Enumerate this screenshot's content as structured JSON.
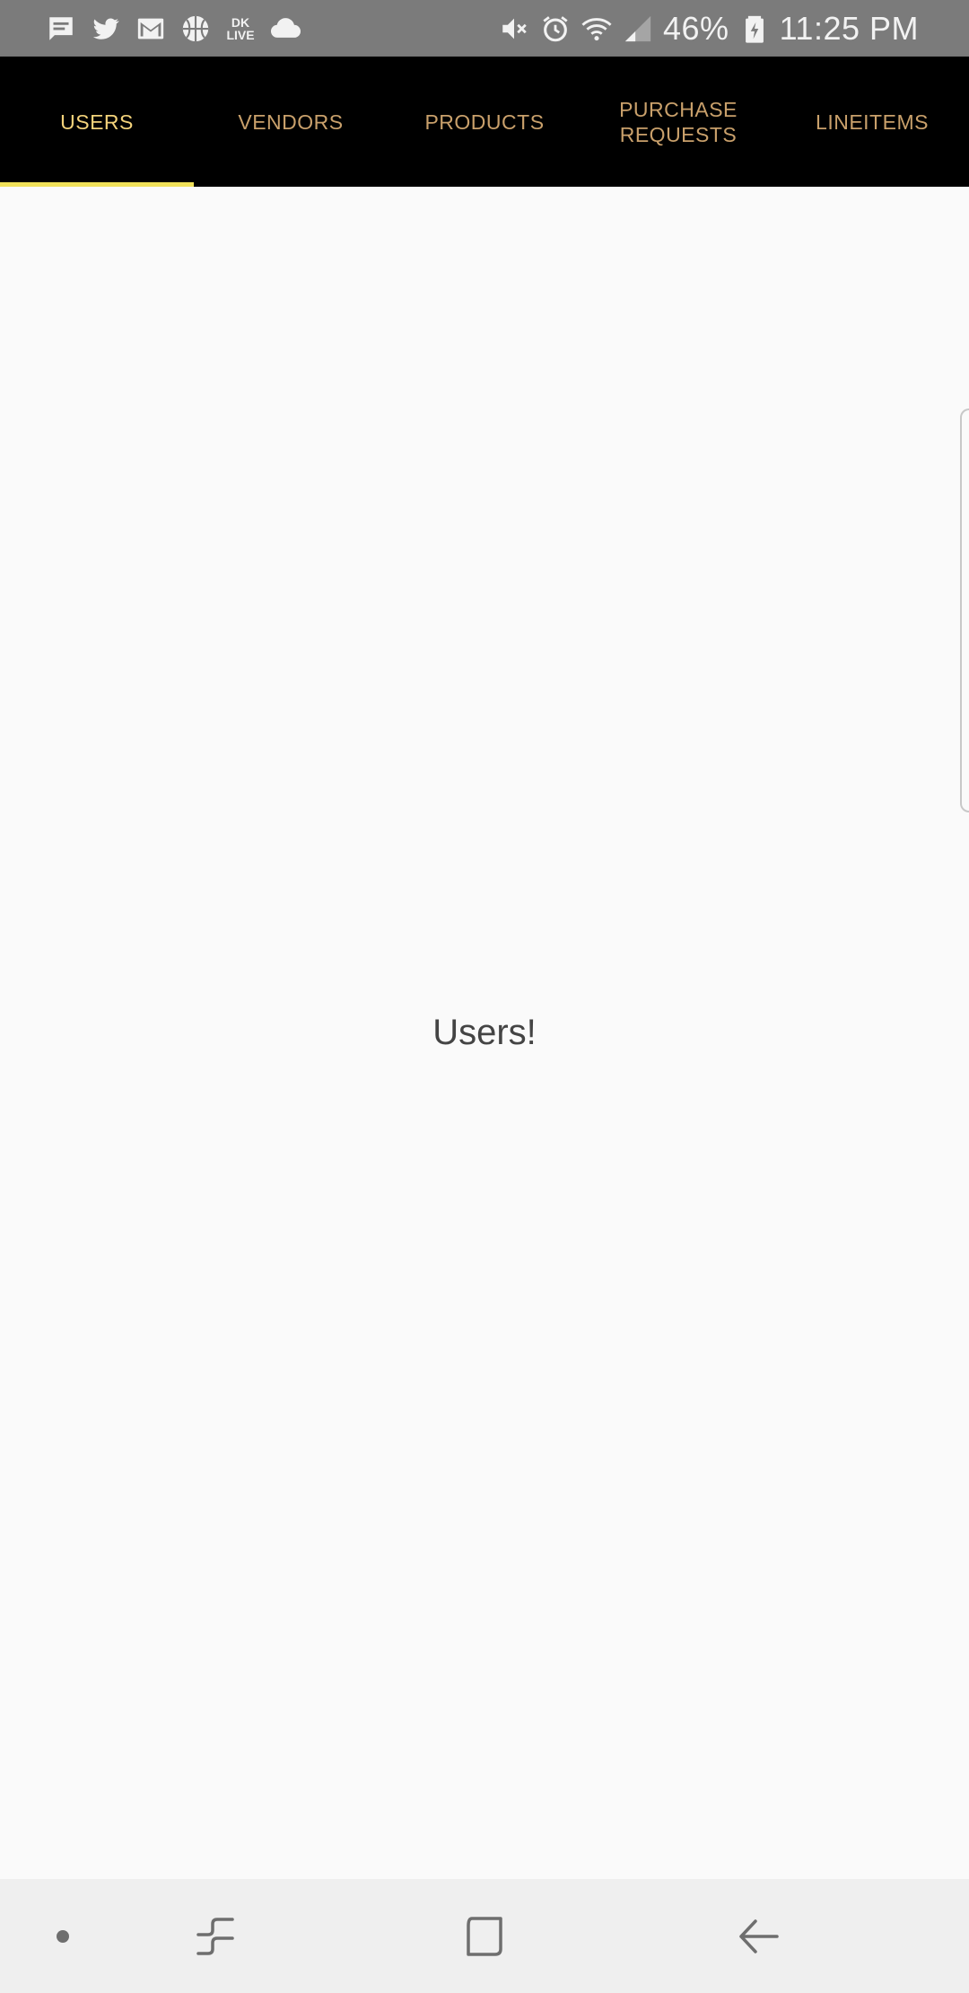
{
  "status_bar": {
    "notification_icons": [
      "message-icon",
      "twitter-icon",
      "gmail-icon",
      "basketball-icon",
      "dk-live-icon",
      "cloud-icon"
    ],
    "dk_live_text_top": "DK",
    "dk_live_text_bottom": "LIVE",
    "system_icons": [
      "mute-icon",
      "alarm-icon",
      "wifi-icon",
      "signal-icon",
      "battery-charging-icon"
    ],
    "battery_percent": "46%",
    "time": "11:25 PM"
  },
  "tabs": [
    {
      "label": "USERS",
      "active": true
    },
    {
      "label": "VENDORS",
      "active": false
    },
    {
      "label": "PRODUCTS",
      "active": false
    },
    {
      "label": "PURCHASE REQUESTS",
      "active": false
    },
    {
      "label": "LINEITEMS",
      "active": false
    }
  ],
  "content": {
    "label": "Users!"
  },
  "colors": {
    "status_bar_bg": "#7b7b7b",
    "tab_bar_bg": "#000000",
    "tab_text": "#c9a06b",
    "tab_text_active": "#f3d27a",
    "tab_indicator": "#f0e15a",
    "content_bg": "#fafafa",
    "nav_bar_bg": "#efefef"
  },
  "nav_bar": {
    "buttons": [
      "dot-indicator-icon",
      "recents-icon",
      "home-icon",
      "back-icon"
    ]
  }
}
